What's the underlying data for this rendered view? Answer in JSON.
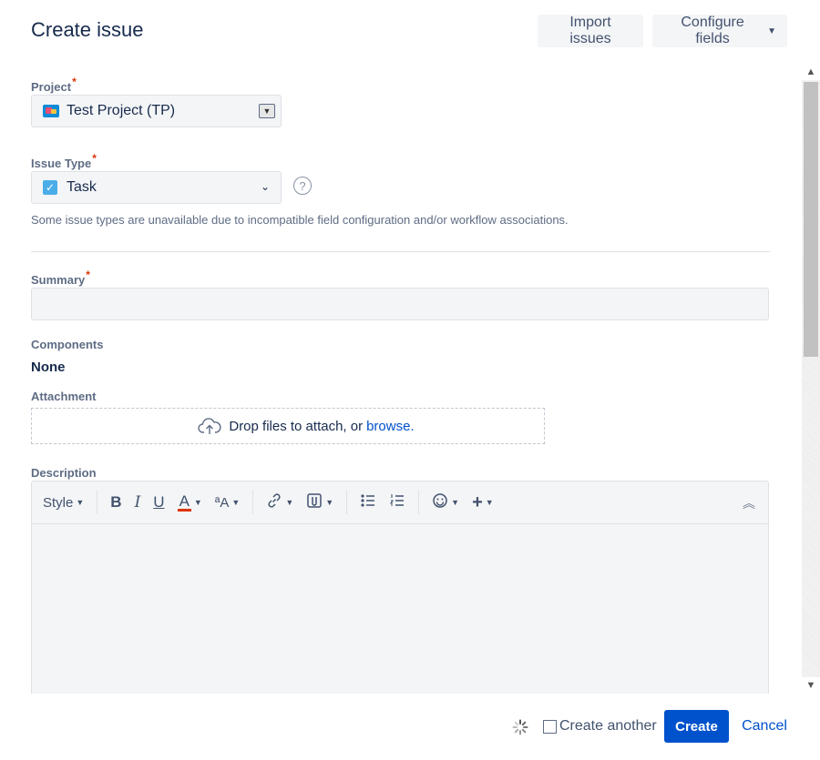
{
  "header": {
    "title": "Create issue",
    "import_label": "Import issues",
    "configure_label": "Configure fields"
  },
  "form": {
    "project": {
      "label": "Project",
      "required_mark": "*",
      "value": "Test Project (TP)"
    },
    "issue_type": {
      "label": "Issue Type",
      "required_mark": "*",
      "value": "Task",
      "note": "Some issue types are unavailable due to incompatible field configuration and/or workflow associations."
    },
    "summary": {
      "label": "Summary",
      "required_mark": "*",
      "value": ""
    },
    "components": {
      "label": "Components",
      "value": "None"
    },
    "attachment": {
      "label": "Attachment",
      "drop_text": "Drop files to attach, or",
      "browse_link": "browse."
    },
    "description": {
      "label": "Description",
      "toolbar": {
        "style_label": "Style",
        "bold": "B",
        "italic": "I",
        "underline": "U",
        "text_color": "A",
        "text_size": "ªA"
      }
    }
  },
  "footer": {
    "create_another_label": "Create another",
    "create_another_checked": false,
    "create_label": "Create",
    "cancel_label": "Cancel"
  },
  "colors": {
    "primary": "#0052cc",
    "required": "#de350b",
    "field_bg": "#f4f5f7",
    "label": "#5e6c84"
  }
}
